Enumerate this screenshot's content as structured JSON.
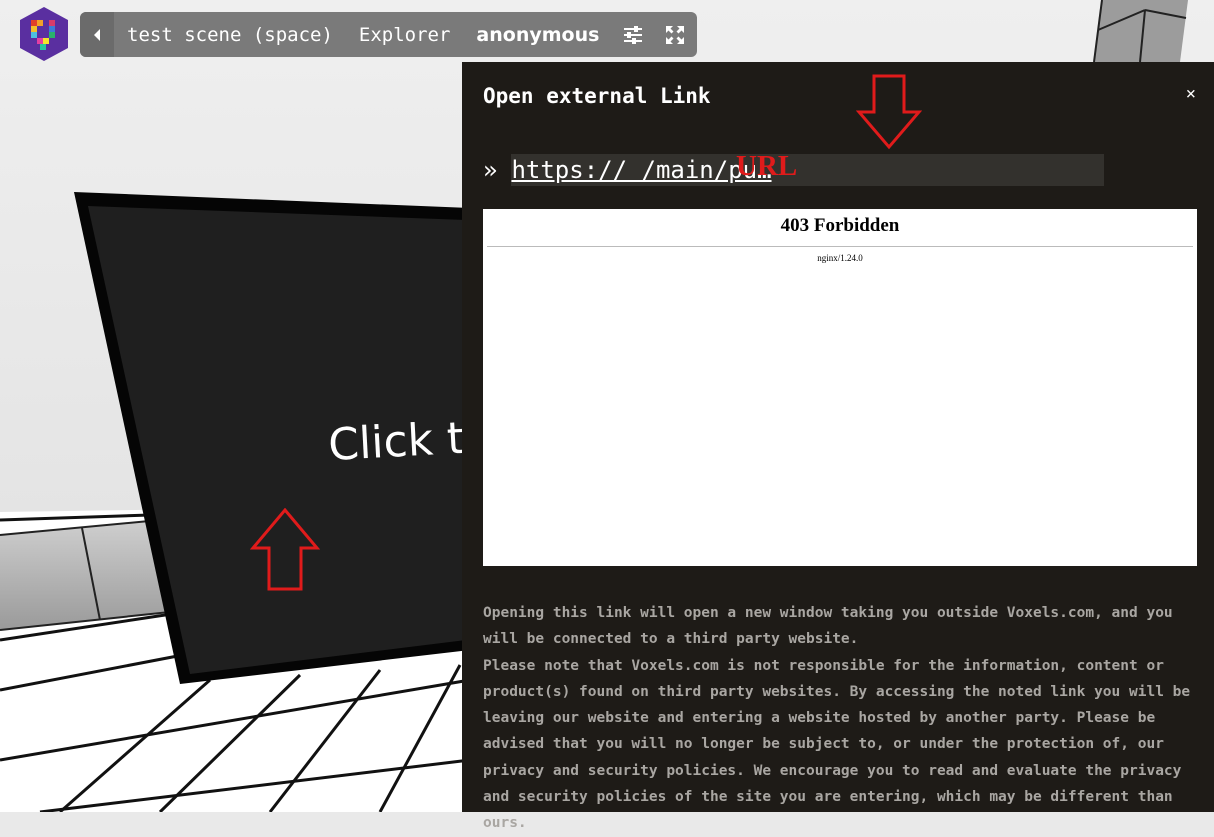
{
  "toolbar": {
    "scene_name": "test scene (space)",
    "explorer_label": "Explorer",
    "user_name": "anonymous",
    "icons": [
      "back-arrow-icon",
      "settings-sliders-icon",
      "fullscreen-icon"
    ]
  },
  "scene": {
    "panel_text": "Click t"
  },
  "modal": {
    "title": "Open external Link",
    "close_label": "×",
    "url_prefix": "»",
    "url_text": "https://                       /main/pu…",
    "preview": {
      "heading": "403 Forbidden",
      "server": "nginx/1.24.0"
    },
    "disclaimer_1": "Opening this link will open a new window taking you outside Voxels.com, and you will be connected to a third party website.",
    "disclaimer_2": "Please note that Voxels.com is not responsible for the information, content or product(s) found on third party websites. By accessing the noted link you will be leaving our website and entering a website hosted by another party. Please be advised that you will no longer be subject to, or under the protection of, our privacy and security policies. We encourage you to read and evaluate the privacy and security policies of the site you are entering, which may be different than ours."
  },
  "annotation": {
    "url_label": "URL",
    "color": "#e01b1b"
  }
}
